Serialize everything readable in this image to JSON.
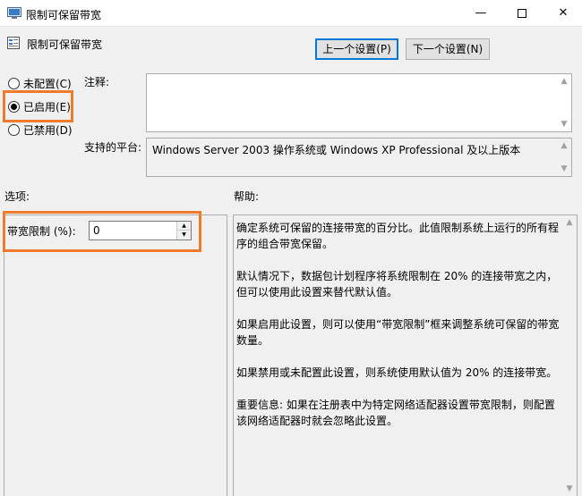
{
  "window": {
    "title": "限制可保留带宽",
    "minimize_glyph": "—",
    "close_glyph": "✕"
  },
  "header": {
    "policy_name": "限制可保留带宽",
    "prev_button": "上一个设置(P)",
    "next_button": "下一个设置(N)"
  },
  "state": {
    "options": [
      {
        "label": "未配置(C)",
        "checked": false
      },
      {
        "label": "已启用(E)",
        "checked": true
      },
      {
        "label": "已禁用(D)",
        "checked": false
      }
    ]
  },
  "comment": {
    "label": "注释:",
    "value": ""
  },
  "platform": {
    "label": "支持的平台:",
    "value": "Windows Server 2003 操作系统或 Windows XP Professional 及以上版本"
  },
  "options_section": {
    "label": "选项:",
    "field_label": "带宽限制 (%):",
    "field_value": "0"
  },
  "help_section": {
    "label": "帮助:",
    "paragraphs": [
      "确定系统可保留的连接带宽的百分比。此值限制系统上运行的所有程序的组合带宽保留。",
      "默认情况下，数据包计划程序将系统限制在 20% 的连接带宽之内，但可以使用此设置来替代默认值。",
      "如果启用此设置，则可以使用“带宽限制”框来调整系统可保留的带宽数量。",
      "如果禁用或未配置此设置，则系统使用默认值为 20% 的连接带宽。",
      "重要信息: 如果在注册表中为特定网络适配器设置带宽限制，则配置该网络适配器时就会忽略此设置。"
    ]
  },
  "colors": {
    "highlight": "#f07a2b",
    "accent": "#0078d7"
  }
}
